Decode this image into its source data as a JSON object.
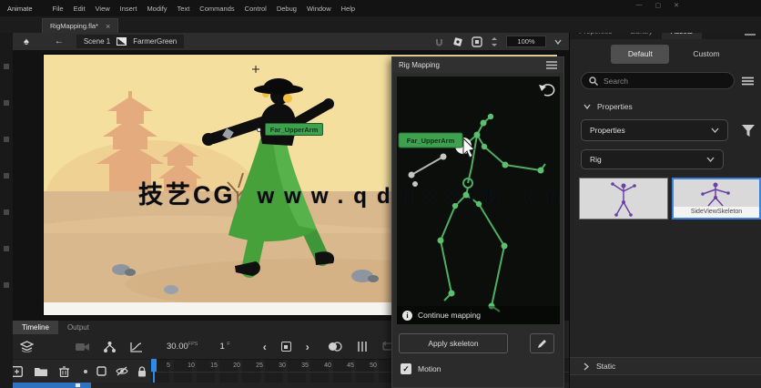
{
  "window": {
    "app_name": "Animate",
    "controls": {
      "minimize": "—",
      "maximize": "▢",
      "close": "✕"
    }
  },
  "menu_bar": {
    "items": [
      "File",
      "Edit",
      "View",
      "Insert",
      "Modify",
      "Text",
      "Commands",
      "Control",
      "Debug",
      "Window",
      "Help"
    ]
  },
  "document_tab": {
    "title": "RigMapping.fla*",
    "close_glyph": "×"
  },
  "edit_bar": {
    "back_glyph": "←",
    "scene_label": "Scene 1",
    "symbol_label": "FarmerGreen",
    "zoom_value": "100%"
  },
  "stage": {
    "selection_tooltip": "Far_UpperArm"
  },
  "rig_mapping_panel": {
    "title": "Rig Mapping",
    "bone_tooltip": "Far_UpperArm",
    "status_message": "Continue mapping",
    "apply_button_label": "Apply skeleton",
    "motion_checkbox": {
      "label": "Motion",
      "checked": true,
      "check_glyph": "✓"
    }
  },
  "assets_panel": {
    "tabs": [
      {
        "label": "Properties"
      },
      {
        "label": "Library"
      },
      {
        "label": "Assets",
        "active": true
      }
    ],
    "view_tabs": [
      {
        "label": "Default",
        "selected": true
      },
      {
        "label": "Custom"
      }
    ],
    "search": {
      "placeholder": "Search"
    },
    "section_header": "Properties",
    "filters": [
      {
        "value": "Properties"
      },
      {
        "value": "Rig"
      }
    ],
    "thumbnails": [
      {
        "label": ""
      },
      {
        "label": "SideViewSkeleton",
        "selected": true
      }
    ],
    "collapsed_sections": [
      {
        "label": "Static"
      }
    ]
  },
  "timeline_panel": {
    "tabs": [
      {
        "label": "Timeline",
        "active": true
      },
      {
        "label": "Output"
      }
    ],
    "frame_rate": "30.00",
    "frame_rate_unit": "FPS",
    "current_frame": "1",
    "current_frame_unit": "F",
    "prev_glyph": "‹",
    "next_glyph": "›",
    "ruler": [
      "5",
      "10",
      "15",
      "20",
      "25",
      "30",
      "35",
      "40",
      "45",
      "50"
    ]
  },
  "watermark": {
    "prefix": "技艺CG",
    "url": "www.qdnxxfb.cn"
  },
  "colors": {
    "accent_green": "#3da14e",
    "skeleton_green": "#5cbf6e",
    "unmapped_gray": "#b5b5b5",
    "selection_blue": "#3f82d8",
    "playhead_blue": "#2d8ceb",
    "stage_sky": "#f4df9f",
    "stage_sand": "#d9b88d",
    "pagoda_orange": "#e3ab7e",
    "character_green": "#46a13b",
    "thumbnail_purple": "#6a3fa6"
  }
}
